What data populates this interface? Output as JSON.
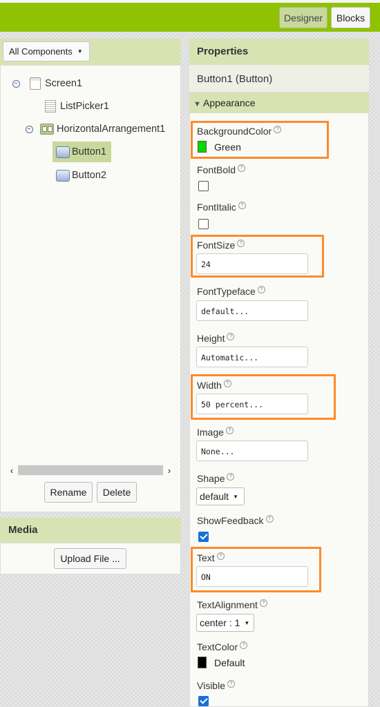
{
  "colors": {
    "topbar": "#8fc202",
    "panel_header": "#d7e3b3",
    "selected": "#c9d89c",
    "highlight": "#ff8a2a",
    "green_swatch": "#00dd00",
    "black_swatch": "#000000",
    "checkbox_on": "#1a6fd8"
  },
  "topbar": {
    "designer_label": "Designer",
    "blocks_label": "Blocks"
  },
  "components": {
    "filter_label": "All Components",
    "tree": [
      {
        "label": "Screen1",
        "icon": "screen-icon",
        "collapse": "collapse-icon"
      },
      {
        "label": "ListPicker1",
        "icon": "listpicker-icon"
      },
      {
        "label": "HorizontalArrangement1",
        "icon": "horizontal-arrangement-icon",
        "collapse": "collapse-icon"
      },
      {
        "label": "Button1",
        "icon": "button-icon",
        "selected": true
      },
      {
        "label": "Button2",
        "icon": "button-icon"
      }
    ],
    "scroll_left": "‹",
    "scroll_right": "›",
    "rename_label": "Rename",
    "delete_label": "Delete"
  },
  "media": {
    "title": "Media",
    "upload_label": "Upload File ..."
  },
  "properties": {
    "title": "Properties",
    "subtitle": "Button1 (Button)",
    "section": "Appearance",
    "section_arrow": "▼",
    "help_glyph": "?",
    "background_color": {
      "label": "BackgroundColor",
      "value": "Green"
    },
    "font_bold": {
      "label": "FontBold",
      "checked": false
    },
    "font_italic": {
      "label": "FontItalic",
      "checked": false
    },
    "font_size": {
      "label": "FontSize",
      "value": "24"
    },
    "font_typeface": {
      "label": "FontTypeface",
      "value": "default..."
    },
    "height": {
      "label": "Height",
      "value": "Automatic..."
    },
    "width": {
      "label": "Width",
      "value": "50 percent..."
    },
    "image": {
      "label": "Image",
      "value": "None..."
    },
    "shape": {
      "label": "Shape",
      "value": "default"
    },
    "show_feedback": {
      "label": "ShowFeedback",
      "checked": true
    },
    "text": {
      "label": "Text",
      "value": "ON"
    },
    "text_alignment": {
      "label": "TextAlignment",
      "value": "center : 1"
    },
    "text_color": {
      "label": "TextColor",
      "value": "Default"
    },
    "visible": {
      "label": "Visible",
      "checked": true
    }
  }
}
